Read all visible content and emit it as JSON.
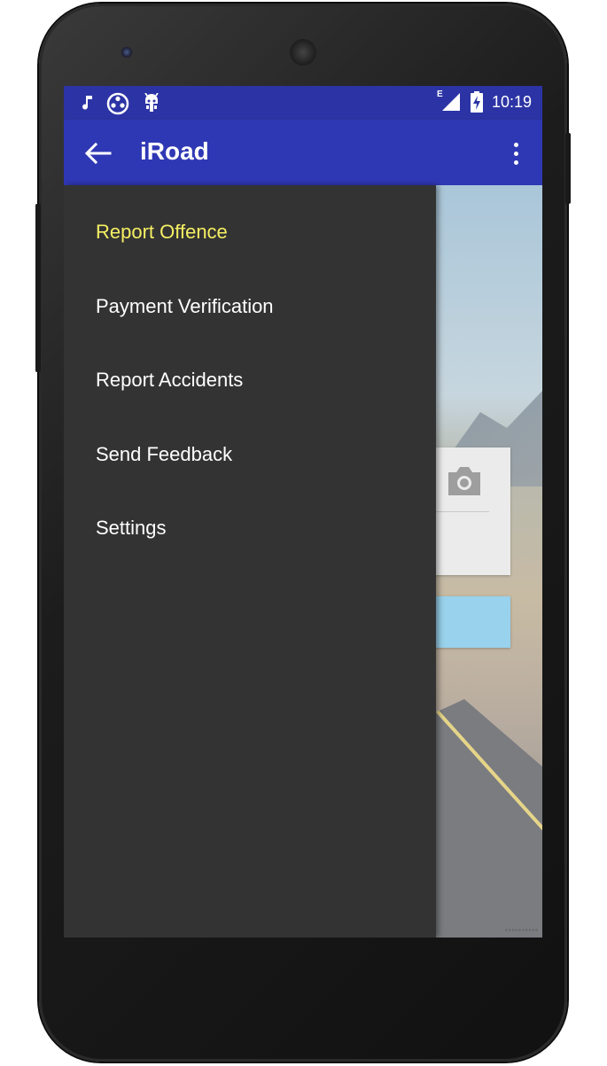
{
  "status_bar": {
    "time": "10:19",
    "network_label": "E",
    "left_icons": [
      "music-note-icon",
      "film-reel-icon",
      "android-bug-icon"
    ],
    "right_icons": [
      "signal-icon",
      "battery-charging-icon"
    ]
  },
  "app_bar": {
    "title": "iRoad",
    "back_icon": "arrow-left-icon",
    "overflow_icon": "more-vert-icon"
  },
  "drawer": {
    "items": [
      {
        "label": "Report Offence",
        "active": true
      },
      {
        "label": "Payment Verification",
        "active": false
      },
      {
        "label": "Report Accidents",
        "active": false
      },
      {
        "label": "Send Feedback",
        "active": false
      },
      {
        "label": "Settings",
        "active": false
      }
    ]
  },
  "background": {
    "camera_icon": "camera-icon"
  },
  "colors": {
    "status_bar": "#2c34a5",
    "app_bar": "#2f38b4",
    "drawer": "#333333",
    "active_item": "#f5ef63",
    "text": "#ffffff",
    "accent_button": "#99d2ec"
  }
}
